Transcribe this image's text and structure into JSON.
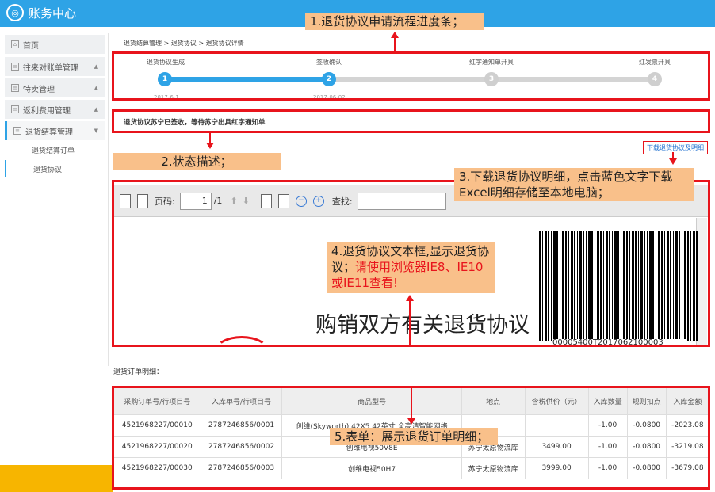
{
  "app": {
    "title": "账务中心"
  },
  "sidebar": {
    "items": [
      {
        "label": "首页"
      },
      {
        "label": "往来对账单管理"
      },
      {
        "label": "特卖管理"
      },
      {
        "label": "返利费用管理"
      },
      {
        "label": "退货结算管理"
      }
    ],
    "sub_items": [
      {
        "label": "退货结算订单"
      },
      {
        "label": "退货协议"
      }
    ]
  },
  "breadcrumb": {
    "text": "退货结算管理 > 退货协议 > 退货协议详情"
  },
  "progress": {
    "steps": [
      {
        "label": "退货协议生成",
        "num": "1",
        "date": "2017-6-1",
        "done": true
      },
      {
        "label": "签收确认",
        "num": "2",
        "date": "2017-06-02",
        "done": true
      },
      {
        "label": "红字通知单开具",
        "num": "3",
        "date": "",
        "done": false
      },
      {
        "label": "红发票开具",
        "num": "4",
        "date": "",
        "done": false
      }
    ],
    "accent_color": "#2ea3e6"
  },
  "status": {
    "text": "退货协议苏宁已签收，等待苏宁出具红字通知单"
  },
  "download": {
    "label": "下载退货协议及明细"
  },
  "viewer": {
    "page_label": "页码:",
    "page_value": "1",
    "page_total": "/1",
    "find_label": "查找:",
    "doc_title": "购销双方有关退货协议",
    "barcode_number": "00005400T2017062100003"
  },
  "annotations": {
    "n1": "1.退货协议申请流程进度条；",
    "n2": "2.状态描述；",
    "n3": "3.下载退货协议明细，点击蓝色文字下载Excel明细存储至本地电脑；",
    "n4a": "4.退货协议文本框,显示退货协议；",
    "n4b": "请使用浏览器IE8、IE10或IE11查看!",
    "n5": "5.表单：展示退货订单明细；"
  },
  "table": {
    "title": "退货订单明细：",
    "headers": [
      "采购订单号/行项目号",
      "入库单号/行项目号",
      "商品型号",
      "地点",
      "含税供价（元）",
      "入库数量",
      "规则扣点",
      "入库金额"
    ],
    "rows": [
      [
        "4521968227/00010",
        "2787246856/0001",
        "创维(Skyworth) 42X5 42英寸 全高清智能网络",
        "",
        "",
        "-1.00",
        "-0.0800",
        "-2023.08"
      ],
      [
        "4521968227/00020",
        "2787246856/0002",
        "创维电视50V8E",
        "苏宁太原物流库",
        "3499.00",
        "-1.00",
        "-0.0800",
        "-3219.08"
      ],
      [
        "4521968227/00030",
        "2787246856/0003",
        "创维电视50H7",
        "苏宁太原物流库",
        "3999.00",
        "-1.00",
        "-0.0800",
        "-3679.08"
      ]
    ]
  }
}
